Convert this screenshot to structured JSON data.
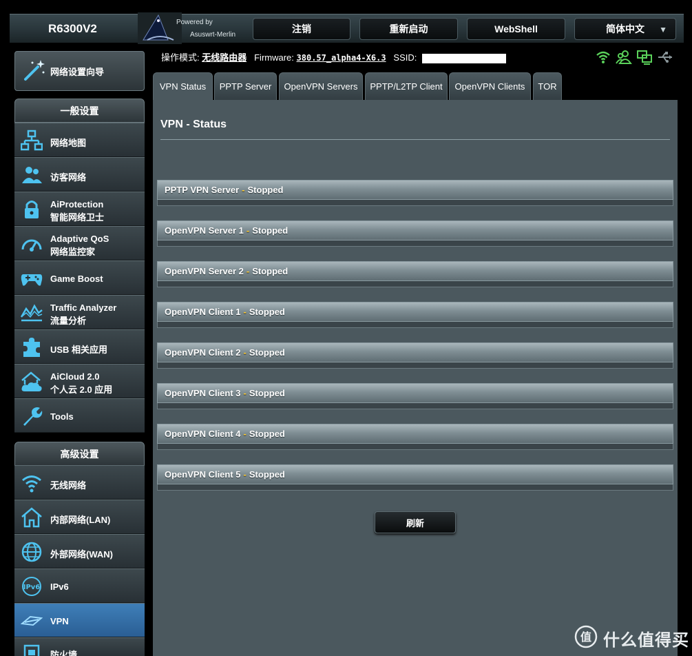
{
  "header": {
    "model": "R6300V2",
    "powered_by": "Powered by",
    "firmware_brand": "Asuswrt-Merlin",
    "buttons": {
      "logout": "注销",
      "reboot": "重新启动",
      "webshell": "WebShell",
      "language": "简体中文"
    }
  },
  "status": {
    "mode_label": "操作模式:",
    "mode_value": "无线路由器",
    "firmware_label": "Firmware:",
    "firmware_value": "380.57_alpha4-X6.3",
    "ssid_label": "SSID:"
  },
  "sidebar": {
    "wizard": "网络设置向导",
    "general_title": "一般设置",
    "general_items": [
      {
        "label": "网络地图",
        "label2": ""
      },
      {
        "label": "访客网络",
        "label2": ""
      },
      {
        "label": "AiProtection",
        "label2": "智能网络卫士"
      },
      {
        "label": "Adaptive QoS",
        "label2": "网络监控家"
      },
      {
        "label": "Game Boost",
        "label2": ""
      },
      {
        "label": "Traffic Analyzer",
        "label2": "流量分析"
      },
      {
        "label": "USB 相关应用",
        "label2": ""
      },
      {
        "label": "AiCloud 2.0",
        "label2": "个人云 2.0 应用"
      },
      {
        "label": "Tools",
        "label2": ""
      }
    ],
    "advanced_title": "高级设置",
    "advanced_items": [
      {
        "label": "无线网络"
      },
      {
        "label": "内部网络(LAN)"
      },
      {
        "label": "外部网络(WAN)"
      },
      {
        "label": "IPv6"
      },
      {
        "label": "VPN"
      },
      {
        "label": "防火墙"
      }
    ]
  },
  "tabs": [
    "VPN Status",
    "PPTP Server",
    "OpenVPN Servers",
    "PPTP/L2TP Client",
    "OpenVPN Clients",
    "TOR"
  ],
  "main": {
    "title": "VPN - Status",
    "rows": [
      {
        "name": "PPTP VPN Server",
        "sep": "-",
        "state": "Stopped"
      },
      {
        "name": "OpenVPN Server 1",
        "sep": "-",
        "state": "Stopped"
      },
      {
        "name": "OpenVPN Server 2",
        "sep": "-",
        "state": "Stopped"
      },
      {
        "name": "OpenVPN Client 1",
        "sep": "-",
        "state": "Stopped"
      },
      {
        "name": "OpenVPN Client 2",
        "sep": "-",
        "state": "Stopped"
      },
      {
        "name": "OpenVPN Client 3",
        "sep": "-",
        "state": "Stopped"
      },
      {
        "name": "OpenVPN Client 4",
        "sep": "-",
        "state": "Stopped"
      },
      {
        "name": "OpenVPN Client 5",
        "sep": "-",
        "state": "Stopped"
      }
    ],
    "refresh": "刷新"
  },
  "watermark": {
    "text": "什么值得买",
    "logo_char": "值"
  },
  "colors": {
    "accent": "#4ec3f0",
    "status_green": "#5ad15a",
    "separator_yellow": "#ffcc33",
    "active_menu": "#3f7fb8"
  },
  "icons": {
    "wizard": "magic-wand-icon",
    "general": [
      "network-map-icon",
      "guest-network-icon",
      "lock-icon",
      "speedometer-icon",
      "gamepad-icon",
      "traffic-chart-icon",
      "puzzle-icon",
      "cloud-home-icon",
      "wrench-icon"
    ],
    "advanced": [
      "wifi-icon",
      "home-icon",
      "globe-icon",
      "ipv6-icon",
      "vpn-icon",
      "firewall-icon"
    ],
    "status": [
      "wifi-status-icon",
      "users-status-icon",
      "network-status-icon",
      "usb-status-icon"
    ]
  }
}
